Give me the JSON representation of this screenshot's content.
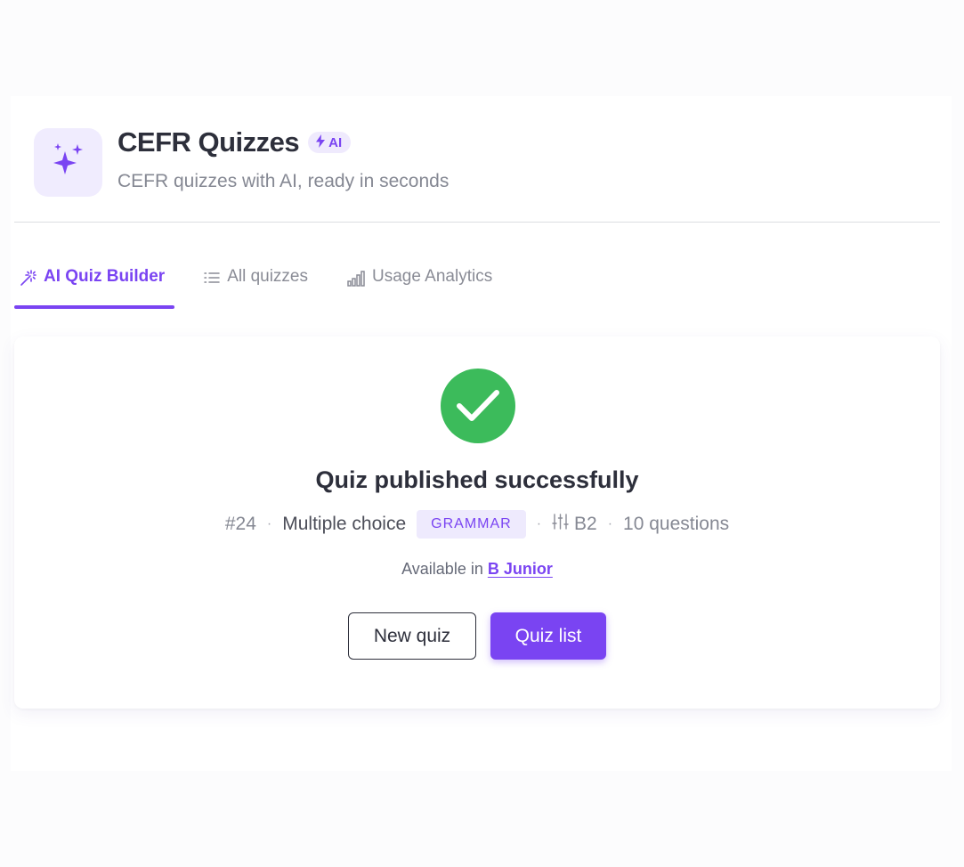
{
  "header": {
    "icon": "sparkles-icon",
    "title": "CEFR Quizzes",
    "badge": "AI",
    "badge_icon": "lightning-icon",
    "subtitle": "CEFR quizzes with AI, ready in seconds"
  },
  "tabs": [
    {
      "label": "AI Quiz Builder",
      "icon": "magic-wand-icon",
      "active": true
    },
    {
      "label": "All quizzes",
      "icon": "list-icon",
      "active": false
    },
    {
      "label": "Usage Analytics",
      "icon": "bar-chart-icon",
      "active": false
    }
  ],
  "result": {
    "icon": "check-circle-icon",
    "title": "Quiz published successfully",
    "meta": {
      "id": "#24",
      "type": "Multiple choice",
      "tag": "GRAMMAR",
      "level_icon": "sliders-icon",
      "level": "B2",
      "questions": "10 questions"
    },
    "availability_prefix": "Available in",
    "availability_link": "B Junior"
  },
  "actions": {
    "secondary_label": "New quiz",
    "primary_label": "Quiz list"
  },
  "colors": {
    "accent": "#7a44f2",
    "success": "#3cbb5b",
    "icon_bg": "#f0ecfe"
  }
}
